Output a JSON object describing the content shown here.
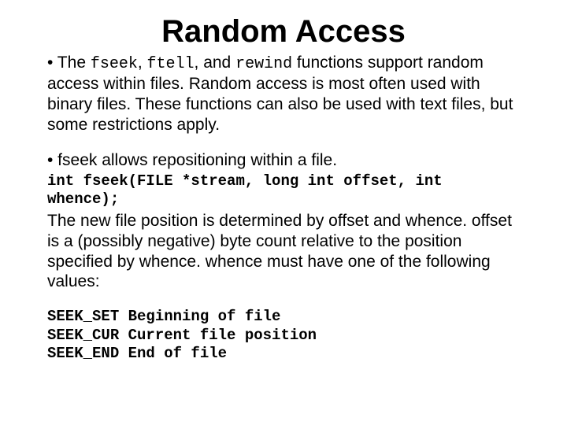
{
  "title": "Random Access",
  "p1_a": "• The ",
  "p1_fn1": "fseek",
  "p1_b": ", ",
  "p1_fn2": "ftell",
  "p1_c": ", and ",
  "p1_fn3": "rewind",
  "p1_d": " functions support random access within files. Random access is most often used with binary files. These functions can also be used with text files, but some restrictions apply.",
  "p2": "• fseek allows repositioning within a file.",
  "sig": "int fseek(FILE *stream, long int offset, int whence);",
  "p3": "The new file position is determined by offset and whence. offset is a (possibly negative) byte count relative to the position specified by whence. whence must have one of the following values:",
  "seek_table": "SEEK_SET Beginning of file\nSEEK_CUR Current file position\nSEEK_END End of file"
}
